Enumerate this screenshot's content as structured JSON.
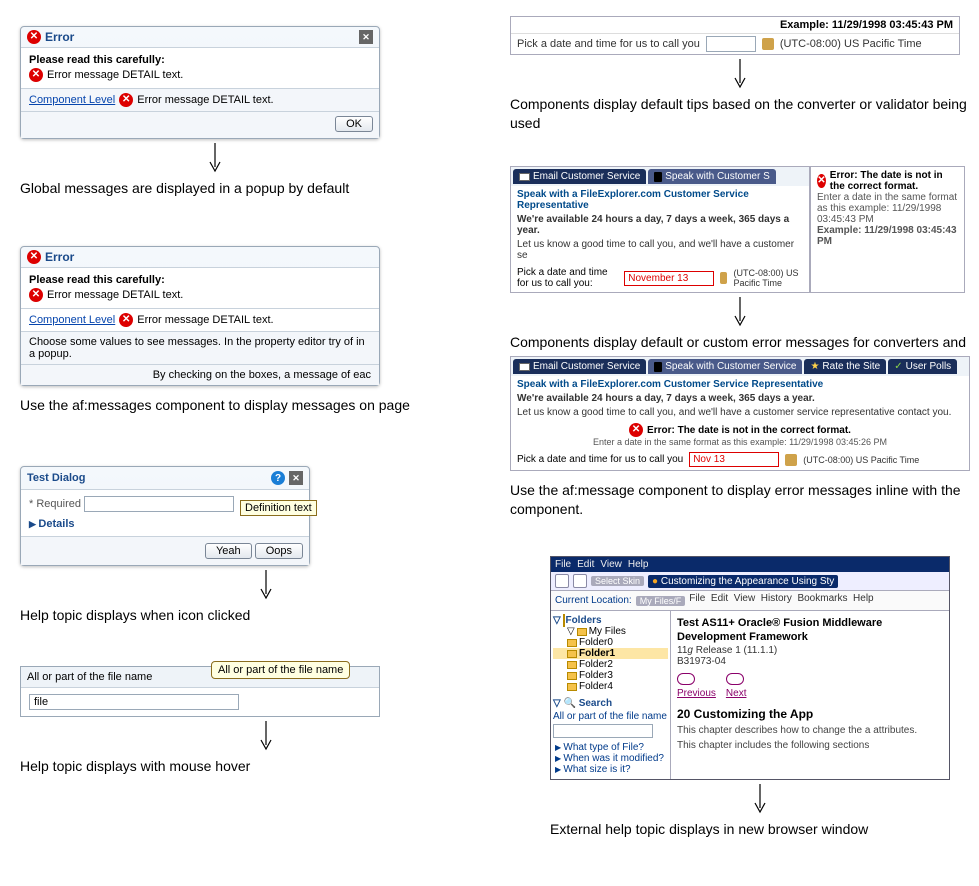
{
  "left": {
    "popup1": {
      "title": "Error",
      "heading": "Please read this carefully:",
      "msg": "Error message DETAIL text.",
      "level": "Component Level",
      "msg2": "Error message DETAIL text.",
      "ok": "OK"
    },
    "caption1": "Global messages are displayed in a popup by default",
    "popup2": {
      "title": "Error",
      "heading": "Please read this carefully:",
      "msg": "Error message DETAIL text.",
      "level": "Component Level",
      "msg2": "Error message DETAIL text.",
      "note": "Choose some values to see messages. In the property editor try of in a popup.",
      "footer": "By checking on the boxes, a message of eac"
    },
    "caption2": "Use the af:messages component to display messages on page",
    "dlg": {
      "title": "Test Dialog",
      "required": "Required",
      "details": "Details",
      "tooltip": "Definition text",
      "yes": "Yeah",
      "no": "Oops"
    },
    "caption3": "Help topic displays when icon clicked",
    "hover": {
      "header": "All or part of the file name",
      "tip": "All or part of the file name",
      "value": "file"
    },
    "caption4": "Help topic displays with mouse hover"
  },
  "right": {
    "tip1": {
      "example": "Example: 11/29/1998 03:45:43 PM",
      "label": "Pick a date and time for us to call you",
      "tz": "(UTC-08:00) US Pacific Time"
    },
    "caption1": "Components display default tips based on the converter or validator being used",
    "tabsA": {
      "tab1": "Email Customer Service",
      "tab2": "Speak with Customer S",
      "banner": "Speak with a FileExplorer.com Customer Service Representative",
      "avail": "We're available 24 hours a day, 7 days a week, 365 days a year.",
      "let": "Let us know a good time to call you, and we'll have a customer se",
      "err_title": "Error: The date is not in the correct format.",
      "err_body": "Enter a date in the same format as this example: 11/29/1998 03:45:43 PM",
      "err_example": "Example: 11/29/1998 03:45:43 PM",
      "fieldlabel": "Pick a date and time for us to call you:",
      "fieldval": "November 13",
      "tz": "(UTC-08:00) US Pacific Time"
    },
    "caption2": "Components display default or custom error messages for converters and validators in a note window.",
    "tabsB": {
      "tab1": "Email Customer Service",
      "tab2": "Speak with Customer Service",
      "tab3": "Rate the Site",
      "tab4": "User Polls",
      "banner": "Speak with a FileExplorer.com Customer Service Representative",
      "avail": "We're available 24 hours a day, 7 days a week, 365 days a year.",
      "let": "Let us know a good time to call you, and we'll have a customer service representative contact you.",
      "err_title": "Error: The date is not in the correct format.",
      "err_body": "Enter a date in the same format as this example: 11/29/1998 03:45:26 PM",
      "fieldlabel": "Pick a date and time for us to call you",
      "fieldval": "Nov 13",
      "tz": "(UTC-08:00) US Pacific Time"
    },
    "caption3": "Use the af:message component to display error messages inline with the component.",
    "browser": {
      "menu": [
        "File",
        "Edit",
        "View",
        "Help"
      ],
      "skin": "Select Skin",
      "tab": "Customizing the Appearance Using Sty",
      "location": "Current Location:",
      "loctab": "My Files/F",
      "submenu": [
        "File",
        "Edit",
        "View",
        "History",
        "Bookmarks",
        "Help"
      ],
      "tree_hdr": "Folders",
      "tree_root": "My Files",
      "tree_items": [
        "Folder0",
        "Folder1",
        "Folder2",
        "Folder3",
        "Folder4"
      ],
      "tree_sel_index": 1,
      "search_hdr": "Search",
      "search_label": "All or part of the file name",
      "q1": "What type of File?",
      "q2": "When was it modified?",
      "q3": "What size is it?",
      "h1a": "Test AS11+ Oracle® Fusion Middleware",
      "h1b": "Development Framework",
      "rel": "11g Release 1 (11.1.1)",
      "part": "B31973-04",
      "prev": "Previous",
      "next": "Next",
      "h2": "20 Customizing the App",
      "p1": "This chapter describes how to change the a attributes.",
      "p2": "This chapter includes the following sections"
    },
    "caption4": "External help topic displays in new browser window"
  },
  "italic_g": "g"
}
